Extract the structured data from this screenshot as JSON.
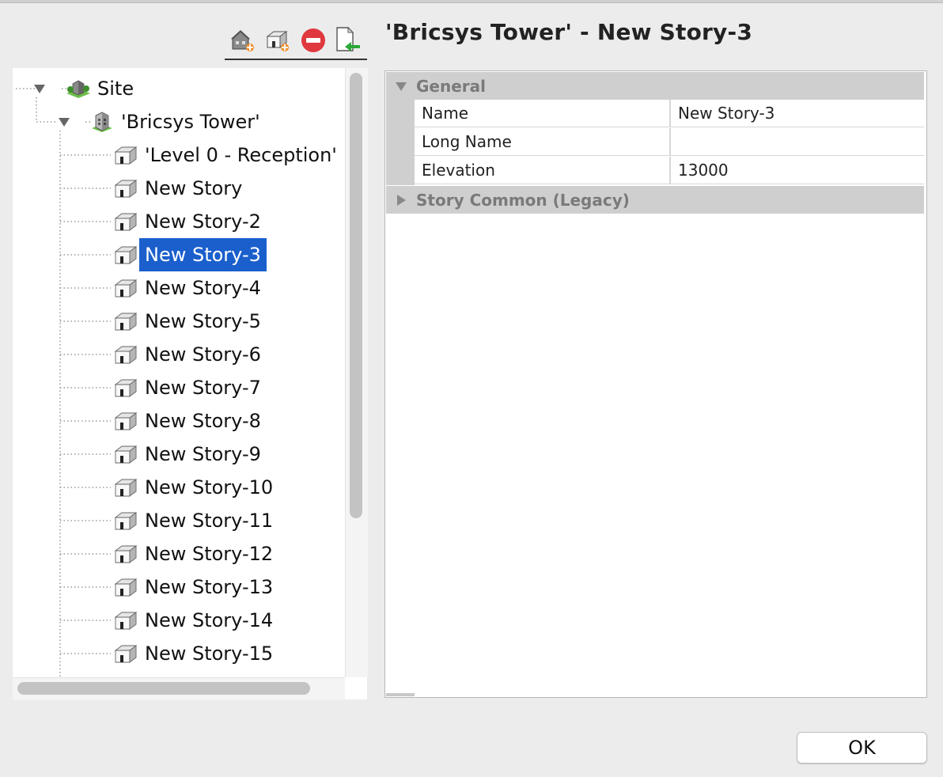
{
  "window": {
    "title": "'Bricsys Tower' - New Story-3"
  },
  "toolbar": {
    "buttons": [
      {
        "icon": "add-building-icon"
      },
      {
        "icon": "add-story-icon"
      },
      {
        "icon": "remove-icon"
      },
      {
        "icon": "import-icon"
      }
    ]
  },
  "tree": {
    "site": {
      "label": "Site",
      "icon": "site-icon",
      "expanded": true
    },
    "building": {
      "label": "'Bricsys Tower'",
      "icon": "building-icon",
      "expanded": true
    },
    "stories": [
      {
        "label": "'Level 0 - Reception'"
      },
      {
        "label": "New Story"
      },
      {
        "label": "New Story-2"
      },
      {
        "label": "New Story-3",
        "selected": true
      },
      {
        "label": "New Story-4"
      },
      {
        "label": "New Story-5"
      },
      {
        "label": "New Story-6"
      },
      {
        "label": "New Story-7"
      },
      {
        "label": "New Story-8"
      },
      {
        "label": "New Story-9"
      },
      {
        "label": "New Story-10"
      },
      {
        "label": "New Story-11"
      },
      {
        "label": "New Story-12"
      },
      {
        "label": "New Story-13"
      },
      {
        "label": "New Story-14"
      },
      {
        "label": "New Story-15"
      }
    ]
  },
  "properties": {
    "general": {
      "label": "General",
      "expanded": true,
      "rows": [
        {
          "name": "Name",
          "value": "New Story-3"
        },
        {
          "name": "Long Name",
          "value": ""
        },
        {
          "name": "Elevation",
          "value": "13000"
        }
      ]
    },
    "story_common": {
      "label": "Story Common (Legacy)",
      "expanded": false
    }
  },
  "buttons": {
    "ok_label": "OK"
  },
  "colors": {
    "selection": "#1a5fcc",
    "category_bg": "#cfcfcf",
    "remove_red": "#e0383f",
    "import_green": "#2aa835"
  }
}
